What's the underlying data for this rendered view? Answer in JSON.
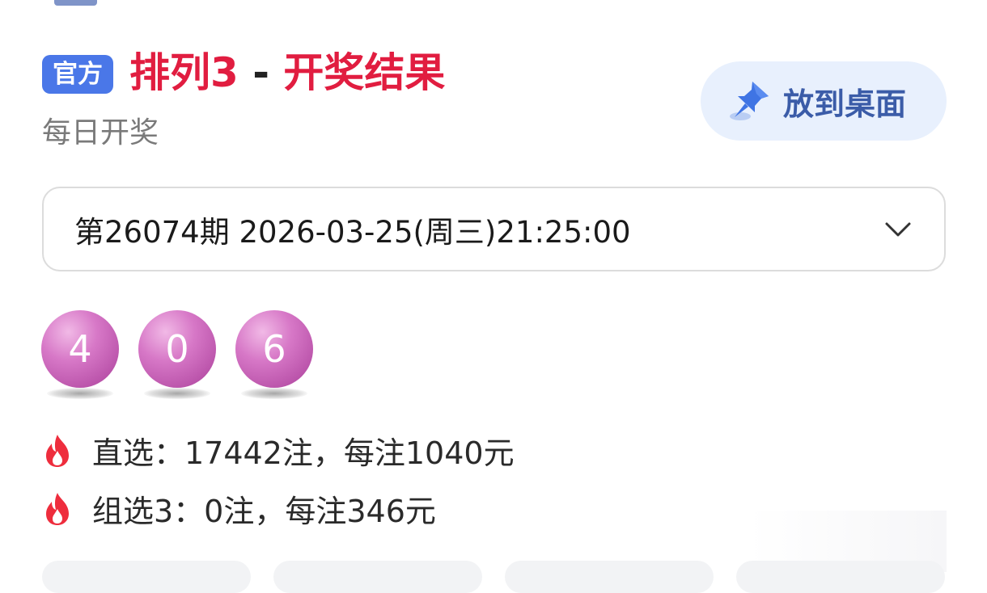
{
  "header": {
    "badge": "官方",
    "title_game": "排列3",
    "title_sep": "-",
    "title_result": "开奖结果",
    "subtitle": "每日开奖",
    "pin_button_label": "放到桌面"
  },
  "issue_select": {
    "value": "第26074期 2026-03-25(周三)21:25:00",
    "icon": "chevron-down-icon"
  },
  "draw_numbers": [
    "4",
    "0",
    "6"
  ],
  "prizes": [
    {
      "icon": "flame-icon",
      "text": "直选：17442注，每注1040元"
    },
    {
      "icon": "flame-icon",
      "text": "组选3：0注，每注346元"
    }
  ],
  "colors": {
    "badge_bg": "#4a77e8",
    "title_red": "#e11d40",
    "pin_button_bg": "#e8f0fd",
    "pin_button_text": "#3b5ca8",
    "ball_purple": "#c765b8",
    "flame_red": "#ee2d3d"
  }
}
